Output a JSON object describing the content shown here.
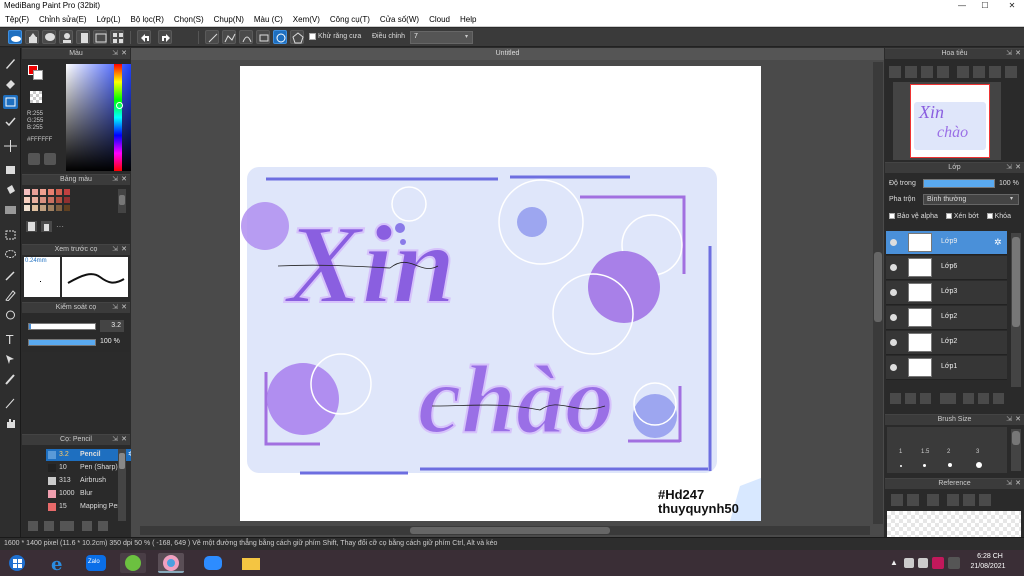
{
  "window": {
    "title": "MediBang Paint Pro (32bit)",
    "minimize": "—",
    "maximize": "☐",
    "close": "✕"
  },
  "menu": [
    "Tệp(F)",
    "Chỉnh sửa(E)",
    "Lớp(L)",
    "Bộ lọc(R)",
    "Chọn(S)",
    "Chụp(N)",
    "Màu (C)",
    "Xem(V)",
    "Công cụ(T)",
    "Cửa số(W)",
    "Cloud",
    "Help"
  ],
  "toolbar": {
    "antialias_label": "Khử răng cưa",
    "correction_label": "Điều chỉnh",
    "correction_value": "7"
  },
  "document": {
    "tab_title": "Untitled"
  },
  "panels": {
    "color": {
      "title": "Màu",
      "r": "R:255",
      "g": "G:255",
      "b": "B:255",
      "hex": "#FFFFFF"
    },
    "palette": {
      "title": "Bảng màu",
      "more": "···"
    },
    "brush_preview": {
      "title": "Xem trước cọ",
      "size": "0.24mm"
    },
    "brush_control": {
      "title": "Kiểm soát cọ",
      "size_value": "3.2",
      "opacity_value": "100 %"
    },
    "brush_list": {
      "title": "Cọ: Pencil",
      "items": [
        {
          "size": "3.2",
          "name": "Pencil",
          "color": "#5a9ad8",
          "selected": true
        },
        {
          "size": "10",
          "name": "Pen (Sharp)",
          "color": "#222222",
          "selected": false
        },
        {
          "size": "313",
          "name": "Airbrush",
          "color": "#cccccc",
          "selected": false
        },
        {
          "size": "1000",
          "name": "Blur",
          "color": "#f0a0b0",
          "selected": false
        },
        {
          "size": "15",
          "name": "Mapping Pen",
          "color": "#e86a6a",
          "selected": false
        }
      ]
    },
    "navigator": {
      "title": "Hoa tiêu"
    },
    "layer": {
      "title": "Lớp",
      "opacity_label": "Độ trong",
      "opacity_value": "100 %",
      "blend_label": "Pha trộn",
      "blend_value": "Bình thường",
      "protect_alpha": "Bảo vệ alpha",
      "clipping": "Xén bớt",
      "lock": "Khóa",
      "layers": [
        {
          "name": "Lớp9",
          "selected": true
        },
        {
          "name": "Lớp6",
          "selected": false
        },
        {
          "name": "Lớp3",
          "selected": false
        },
        {
          "name": "Lớp2",
          "selected": false
        },
        {
          "name": "Lớp2",
          "selected": false
        },
        {
          "name": "Lớp1",
          "selected": false
        }
      ]
    },
    "brush_size": {
      "title": "Brush Size",
      "sizes": [
        "1",
        "1.5",
        "2",
        "3"
      ]
    },
    "reference": {
      "title": "Reference"
    }
  },
  "artwork": {
    "title_line1": "Xin",
    "title_line2": "chào",
    "watermark_tag": "#Hd247",
    "watermark_name": "thuyquynh50"
  },
  "status": {
    "text": "1600 * 1400 pixel  (11.6 * 10.2cm)  350 dpi  50 %  ( -168, 649 )  Vẽ một đường thẳng bằng cách giữ phím Shift, Thay đổi cỡ cọ bằng cách giữ phím Ctrl, Alt và kéo"
  },
  "taskbar": {
    "time": "6:28 CH",
    "date": "21/08/2021",
    "zalo": "Zalo"
  },
  "colors": {
    "accent": "#1e6fc0",
    "art_bg": "#dfe6fa",
    "purple": "#8a63e0",
    "violet": "#a07ee8",
    "lavender": "#c9a9f0"
  }
}
